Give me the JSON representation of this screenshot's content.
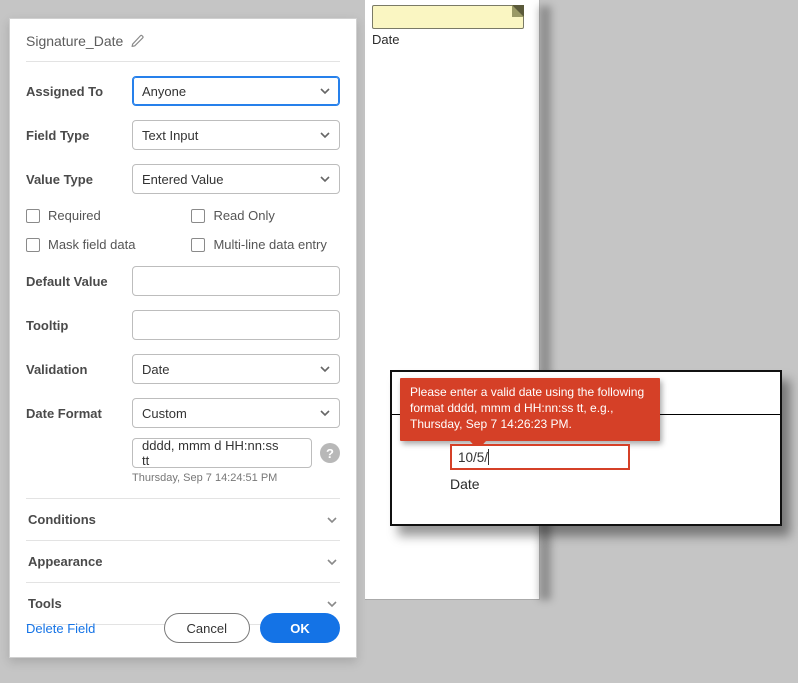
{
  "panel": {
    "title": "Signature_Date",
    "assigned_to": {
      "label": "Assigned To",
      "value": "Anyone"
    },
    "field_type": {
      "label": "Field Type",
      "value": "Text Input"
    },
    "value_type": {
      "label": "Value Type",
      "value": "Entered Value"
    },
    "checks": {
      "required": "Required",
      "read_only": "Read Only",
      "mask": "Mask field data",
      "multiline": "Multi-line data entry"
    },
    "default_value": {
      "label": "Default Value",
      "value": ""
    },
    "tooltip": {
      "label": "Tooltip",
      "value": ""
    },
    "validation": {
      "label": "Validation",
      "value": "Date"
    },
    "date_format": {
      "label": "Date Format",
      "value": "Custom"
    },
    "custom_format_input": "dddd, mmm d  HH:nn:ss tt",
    "custom_format_preview": "Thursday, Sep 7 14:24:51 PM",
    "accordion": {
      "conditions": "Conditions",
      "appearance": "Appearance",
      "tools": "Tools"
    },
    "footer": {
      "delete": "Delete Field",
      "cancel": "Cancel",
      "ok": "OK"
    }
  },
  "doc": {
    "date_label": "Date"
  },
  "error": {
    "message": "Please enter a valid date using the following format dddd, mmm d HH:nn:ss tt, e.g., Thursday, Sep 7 14:26:23 PM.",
    "input_value": "10/5/",
    "field_label": "Date"
  },
  "help_icon": "?"
}
